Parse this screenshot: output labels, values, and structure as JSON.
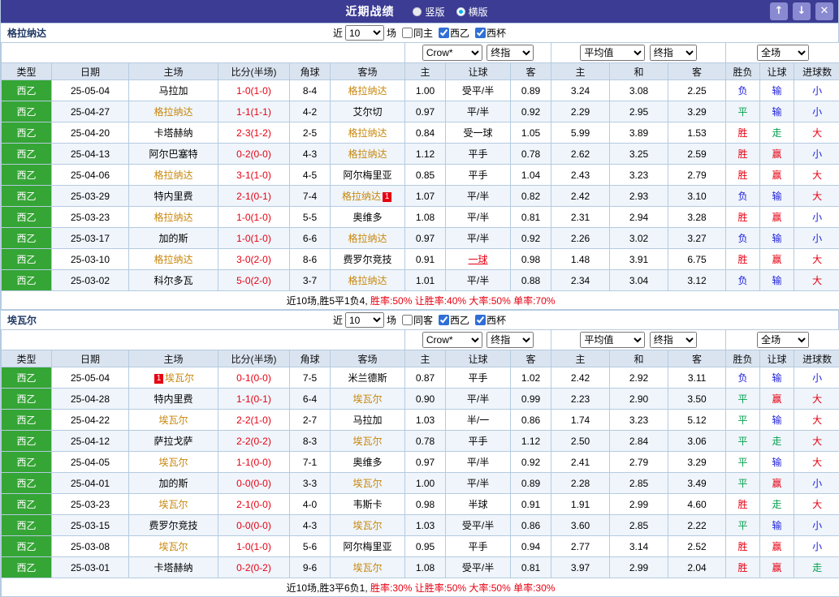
{
  "titlebar": {
    "title": "近期战绩",
    "vertical_label": "竖版",
    "vertical_selected": false,
    "horizontal_label": "横版",
    "horizontal_selected": true,
    "up_icon": "↑",
    "down_icon": "↓",
    "close_icon": "✕"
  },
  "colors": {
    "header_purple": "#3c3c94",
    "league_badge_green": "#35a535",
    "focus_team_orange": "#c8860b",
    "win_red": "#e60012",
    "loss_blue": "#2020dd",
    "draw_green": "#08a050",
    "head_bg": "#dae4f1"
  },
  "controls": {
    "near_label": "近",
    "match_count": "10",
    "field_label": "场",
    "league_label": "西乙",
    "cup_label": "西杯",
    "odds_company": "Crow*",
    "final_label": "终指",
    "average_label": "平均值",
    "scope_label": "全场"
  },
  "columns": {
    "type": "类型",
    "date": "日期",
    "home": "主场",
    "score": "比分(半场)",
    "corner": "角球",
    "away": "客场",
    "host": "主",
    "handicap": "让球",
    "guest": "客",
    "host2": "主",
    "draw": "和",
    "guest2": "客",
    "result": "胜负",
    "handicap_result": "让球",
    "goals": "进球数"
  },
  "tables": [
    {
      "team": "格拉纳达",
      "same_label": "同主",
      "same_checked": false,
      "league_checked": true,
      "cup_checked": true,
      "rows": [
        {
          "type": "西乙",
          "date": "25-05-04",
          "home": "马拉加",
          "away": "格拉纳达",
          "away_focus": true,
          "score": "1-0(1-0)",
          "corner": "8-4",
          "o1": "1.00",
          "handicap": "受平/半",
          "o2": "0.89",
          "e1": "3.24",
          "e2": "3.08",
          "e3": "2.25",
          "r1": "负",
          "r2": "输",
          "r3": "小"
        },
        {
          "type": "西乙",
          "date": "25-04-27",
          "home": "格拉纳达",
          "home_focus": true,
          "away": "艾尔切",
          "score": "1-1(1-1)",
          "corner": "4-2",
          "o1": "0.97",
          "handicap": "平/半",
          "o2": "0.92",
          "e1": "2.29",
          "e2": "2.95",
          "e3": "3.29",
          "r1": "平",
          "r2": "输",
          "r3": "小"
        },
        {
          "type": "西乙",
          "date": "25-04-20",
          "home": "卡塔赫纳",
          "away": "格拉纳达",
          "away_focus": true,
          "score": "2-3(1-2)",
          "corner": "2-5",
          "o1": "0.84",
          "handicap": "受一球",
          "o2": "1.05",
          "e1": "5.99",
          "e2": "3.89",
          "e3": "1.53",
          "r1": "胜",
          "r2": "走",
          "r3": "大"
        },
        {
          "type": "西乙",
          "date": "25-04-13",
          "home": "阿尔巴塞特",
          "away": "格拉纳达",
          "away_focus": true,
          "score": "0-2(0-0)",
          "corner": "4-3",
          "o1": "1.12",
          "handicap": "平手",
          "o2": "0.78",
          "e1": "2.62",
          "e2": "3.25",
          "e3": "2.59",
          "r1": "胜",
          "r2": "赢",
          "r3": "小"
        },
        {
          "type": "西乙",
          "date": "25-04-06",
          "home": "格拉纳达",
          "home_focus": true,
          "away": "阿尔梅里亚",
          "score": "3-1(1-0)",
          "corner": "4-5",
          "o1": "0.85",
          "handicap": "平手",
          "o2": "1.04",
          "e1": "2.43",
          "e2": "3.23",
          "e3": "2.79",
          "r1": "胜",
          "r2": "赢",
          "r3": "大"
        },
        {
          "type": "西乙",
          "date": "25-03-29",
          "home": "特内里费",
          "away": "格拉纳达",
          "away_focus": true,
          "away_card_post": "1",
          "score": "2-1(0-1)",
          "corner": "7-4",
          "o1": "1.07",
          "handicap": "平/半",
          "o2": "0.82",
          "e1": "2.42",
          "e2": "2.93",
          "e3": "3.10",
          "r1": "负",
          "r2": "输",
          "r3": "大"
        },
        {
          "type": "西乙",
          "date": "25-03-23",
          "home": "格拉纳达",
          "home_focus": true,
          "away": "奥维多",
          "score": "1-0(1-0)",
          "corner": "5-5",
          "o1": "1.08",
          "handicap": "平/半",
          "o2": "0.81",
          "e1": "2.31",
          "e2": "2.94",
          "e3": "3.28",
          "r1": "胜",
          "r2": "赢",
          "r3": "小"
        },
        {
          "type": "西乙",
          "date": "25-03-17",
          "home": "加的斯",
          "away": "格拉纳达",
          "away_focus": true,
          "score": "1-0(1-0)",
          "corner": "6-6",
          "o1": "0.97",
          "handicap": "平/半",
          "o2": "0.92",
          "e1": "2.26",
          "e2": "3.02",
          "e3": "3.27",
          "r1": "负",
          "r2": "输",
          "r3": "小"
        },
        {
          "type": "西乙",
          "date": "25-03-10",
          "home": "格拉纳达",
          "home_focus": true,
          "away": "费罗尔竞技",
          "score": "3-0(2-0)",
          "corner": "8-6",
          "o1": "0.91",
          "handicap": "一球",
          "handicap_red": true,
          "o2": "0.98",
          "e1": "1.48",
          "e2": "3.91",
          "e3": "6.75",
          "r1": "胜",
          "r2": "赢",
          "r3": "大"
        },
        {
          "type": "西乙",
          "date": "25-03-02",
          "home": "科尔多瓦",
          "away": "格拉纳达",
          "away_focus": true,
          "score": "5-0(2-0)",
          "corner": "3-7",
          "o1": "1.01",
          "handicap": "平/半",
          "o2": "0.88",
          "e1": "2.34",
          "e2": "3.04",
          "e3": "3.12",
          "r1": "负",
          "r2": "输",
          "r3": "大"
        }
      ],
      "summary": {
        "record": "近10场,胜5平1负4,",
        "rates": "胜率:50% 让胜率:40% 大率:50% 单率:70%"
      }
    },
    {
      "team": "埃瓦尔",
      "same_label": "同客",
      "same_checked": false,
      "league_checked": true,
      "cup_checked": true,
      "rows": [
        {
          "type": "西乙",
          "date": "25-05-04",
          "home": "埃瓦尔",
          "home_focus": true,
          "home_card_pre": "1",
          "away": "米兰德斯",
          "score": "0-1(0-0)",
          "corner": "7-5",
          "o1": "0.87",
          "handicap": "平手",
          "o2": "1.02",
          "e1": "2.42",
          "e2": "2.92",
          "e3": "3.11",
          "r1": "负",
          "r2": "输",
          "r3": "小"
        },
        {
          "type": "西乙",
          "date": "25-04-28",
          "home": "特内里费",
          "away": "埃瓦尔",
          "away_focus": true,
          "score": "1-1(0-1)",
          "corner": "6-4",
          "o1": "0.90",
          "handicap": "平/半",
          "o2": "0.99",
          "e1": "2.23",
          "e2": "2.90",
          "e3": "3.50",
          "r1": "平",
          "r2": "赢",
          "r3": "大"
        },
        {
          "type": "西乙",
          "date": "25-04-22",
          "home": "埃瓦尔",
          "home_focus": true,
          "away": "马拉加",
          "score": "2-2(1-0)",
          "corner": "2-7",
          "o1": "1.03",
          "handicap": "半/一",
          "o2": "0.86",
          "e1": "1.74",
          "e2": "3.23",
          "e3": "5.12",
          "r1": "平",
          "r2": "输",
          "r3": "大"
        },
        {
          "type": "西乙",
          "date": "25-04-12",
          "home": "萨拉戈萨",
          "away": "埃瓦尔",
          "away_focus": true,
          "score": "2-2(0-2)",
          "corner": "8-3",
          "o1": "0.78",
          "handicap": "平手",
          "o2": "1.12",
          "e1": "2.50",
          "e2": "2.84",
          "e3": "3.06",
          "r1": "平",
          "r2": "走",
          "r3": "大"
        },
        {
          "type": "西乙",
          "date": "25-04-05",
          "home": "埃瓦尔",
          "home_focus": true,
          "away": "奥维多",
          "score": "1-1(0-0)",
          "corner": "7-1",
          "o1": "0.97",
          "handicap": "平/半",
          "o2": "0.92",
          "e1": "2.41",
          "e2": "2.79",
          "e3": "3.29",
          "r1": "平",
          "r2": "输",
          "r3": "大"
        },
        {
          "type": "西乙",
          "date": "25-04-01",
          "home": "加的斯",
          "away": "埃瓦尔",
          "away_focus": true,
          "score": "0-0(0-0)",
          "corner": "3-3",
          "o1": "1.00",
          "handicap": "平/半",
          "o2": "0.89",
          "e1": "2.28",
          "e2": "2.85",
          "e3": "3.49",
          "r1": "平",
          "r2": "赢",
          "r3": "小"
        },
        {
          "type": "西乙",
          "date": "25-03-23",
          "home": "埃瓦尔",
          "home_focus": true,
          "away": "韦斯卡",
          "score": "2-1(0-0)",
          "corner": "4-0",
          "o1": "0.98",
          "handicap": "半球",
          "o2": "0.91",
          "e1": "1.91",
          "e2": "2.99",
          "e3": "4.60",
          "r1": "胜",
          "r2": "走",
          "r3": "大"
        },
        {
          "type": "西乙",
          "date": "25-03-15",
          "home": "费罗尔竞技",
          "away": "埃瓦尔",
          "away_focus": true,
          "score": "0-0(0-0)",
          "corner": "4-3",
          "o1": "1.03",
          "handicap": "受平/半",
          "o2": "0.86",
          "e1": "3.60",
          "e2": "2.85",
          "e3": "2.22",
          "r1": "平",
          "r2": "输",
          "r3": "小"
        },
        {
          "type": "西乙",
          "date": "25-03-08",
          "home": "埃瓦尔",
          "home_focus": true,
          "away": "阿尔梅里亚",
          "score": "1-0(1-0)",
          "corner": "5-6",
          "o1": "0.95",
          "handicap": "平手",
          "o2": "0.94",
          "e1": "2.77",
          "e2": "3.14",
          "e3": "2.52",
          "r1": "胜",
          "r2": "赢",
          "r3": "小"
        },
        {
          "type": "西乙",
          "date": "25-03-01",
          "home": "卡塔赫纳",
          "away": "埃瓦尔",
          "away_focus": true,
          "score": "0-2(0-2)",
          "corner": "9-6",
          "o1": "1.08",
          "handicap": "受平/半",
          "o2": "0.81",
          "e1": "3.97",
          "e2": "2.99",
          "e3": "2.04",
          "r1": "胜",
          "r2": "赢",
          "r3": "走"
        }
      ],
      "summary": {
        "record": "近10场,胜3平6负1,",
        "rates": "胜率:30% 让胜率:50% 大率:50% 单率:30%"
      }
    }
  ]
}
